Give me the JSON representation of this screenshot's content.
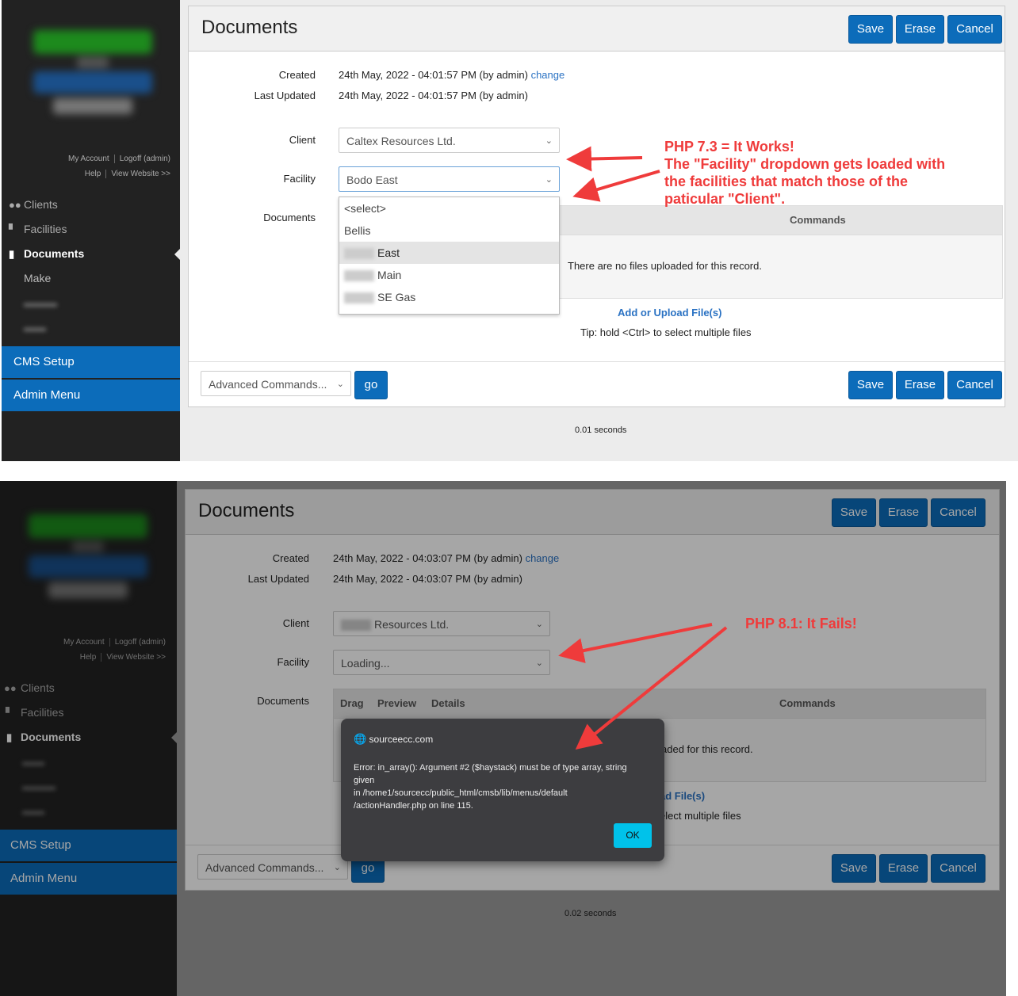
{
  "panel1": {
    "sidebar": {
      "account_links": [
        "My Account",
        "Logoff (admin)"
      ],
      "help_links": [
        "Help",
        "View Website >>"
      ],
      "nav": [
        {
          "label": "Clients",
          "icon": "users-icon"
        },
        {
          "label": "Facilities",
          "icon": "industry-icon"
        },
        {
          "label": "Documents",
          "icon": "document-icon",
          "active": true
        },
        {
          "label": "Make"
        }
      ],
      "cms_setup": "CMS Setup",
      "admin_menu": "Admin Menu"
    },
    "header": {
      "title": "Documents",
      "save": "Save",
      "erase": "Erase",
      "cancel": "Cancel"
    },
    "fields": {
      "created_label": "Created",
      "created_value": "24th May, 2022 - 04:01:57 PM (by admin)",
      "change_link": "change",
      "updated_label": "Last Updated",
      "updated_value": "24th May, 2022 - 04:01:57 PM (by admin)",
      "client_label": "Client",
      "client_value": "Caltex Resources Ltd.",
      "facility_label": "Facility",
      "facility_value": "Bodo East",
      "documents_label": "Documents"
    },
    "facility_options": [
      "<select>",
      "Bellis",
      "East",
      "Main",
      "SE Gas"
    ],
    "table": {
      "commands_header": "Commands",
      "empty_message": "There are no files uploaded for this record."
    },
    "upload_link": "Add or Upload File(s)",
    "tip": "Tip: hold <Ctrl> to select multiple files",
    "footer": {
      "advanced_placeholder": "Advanced Commands...",
      "go": "go",
      "save": "Save",
      "erase": "Erase",
      "cancel": "Cancel"
    },
    "timing": "0.01 seconds",
    "annotation": [
      "PHP 7.3 = It Works!",
      "The \"Facility\" dropdown gets loaded with",
      "the facilities that match those of the",
      "paticular \"Client\"."
    ]
  },
  "panel2": {
    "sidebar": {
      "account_links": [
        "My Account",
        "Logoff (admin)"
      ],
      "help_links": [
        "Help",
        "View Website >>"
      ],
      "nav": [
        {
          "label": "Clients",
          "icon": "users-icon"
        },
        {
          "label": "Facilities",
          "icon": "industry-icon"
        },
        {
          "label": "Documents",
          "icon": "document-icon",
          "active": true
        }
      ],
      "cms_setup": "CMS Setup",
      "admin_menu": "Admin Menu"
    },
    "header": {
      "title": "Documents",
      "save": "Save",
      "erase": "Erase",
      "cancel": "Cancel"
    },
    "fields": {
      "created_label": "Created",
      "created_value": "24th May, 2022 - 04:03:07 PM (by admin)",
      "change_link": "change",
      "updated_label": "Last Updated",
      "updated_value": "24th May, 2022 - 04:03:07 PM (by admin)",
      "client_label": "Client",
      "client_value": "Resources Ltd.",
      "facility_label": "Facility",
      "facility_value": "Loading...",
      "documents_label": "Documents"
    },
    "table": {
      "headers": [
        "Drag",
        "Preview",
        "Details",
        "Commands"
      ],
      "empty_message_fragment": "aded for this record."
    },
    "upload_fragment": "ad File(s)",
    "tip_fragment": "elect multiple files",
    "footer": {
      "advanced_placeholder": "Advanced Commands...",
      "go": "go",
      "save": "Save",
      "erase": "Erase",
      "cancel": "Cancel"
    },
    "timing": "0.02 seconds",
    "annotation": "PHP 8.1: It Fails!",
    "dialog": {
      "site": "sourceecc.com",
      "message_1": "Error: in_array(): Argument #2 ($haystack) must be of type array, string",
      "message_2": "given",
      "message_3": "in /home1/sourcecc/public_html/cmsb/lib/menus/default",
      "message_4": "/actionHandler.php on line 115.",
      "ok": "OK"
    }
  },
  "colors": {
    "accent": "#0c6cba",
    "annotation": "#ef3b3b",
    "dialog_ok": "#00c2ea"
  }
}
